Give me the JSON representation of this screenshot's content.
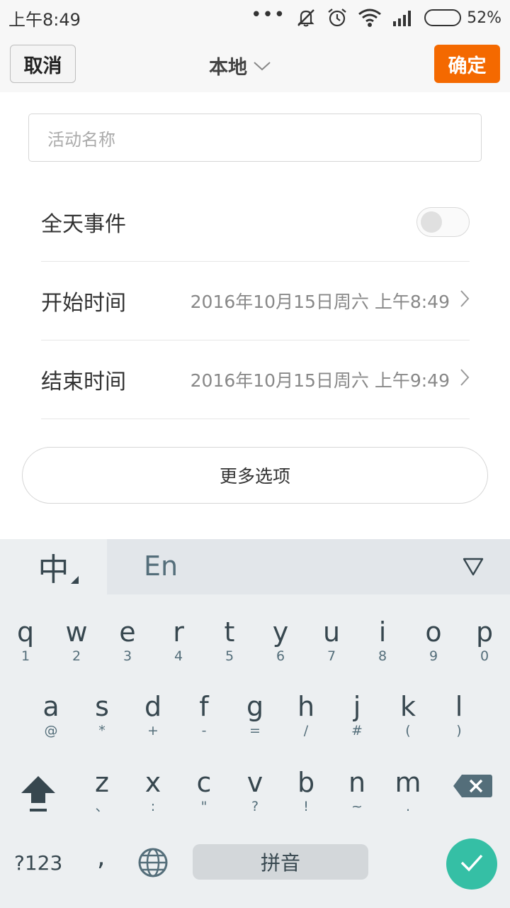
{
  "status_bar": {
    "time": "上午8:49",
    "battery_level": 52,
    "battery_text": "52%",
    "icons": [
      "more-dots-icon",
      "mute-icon",
      "alarm-icon",
      "wifi-icon",
      "signal-icon",
      "battery-icon"
    ]
  },
  "top_bar": {
    "cancel_label": "取消",
    "calendar_label": "本地",
    "confirm_label": "确定",
    "confirm_color": "#f46900"
  },
  "form": {
    "event_name_placeholder": "活动名称",
    "all_day_label": "全天事件",
    "all_day_on": false,
    "start_label": "开始时间",
    "start_value": "2016年10月15日周六 上午8:49",
    "end_label": "结束时间",
    "end_value": "2016年10月15日周六 上午9:49",
    "more_options_label": "更多选项"
  },
  "keyboard": {
    "lang_zh": "中",
    "lang_en": "En",
    "row1": [
      {
        "key": "q",
        "sub": "1"
      },
      {
        "key": "w",
        "sub": "2"
      },
      {
        "key": "e",
        "sub": "3"
      },
      {
        "key": "r",
        "sub": "4"
      },
      {
        "key": "t",
        "sub": "5"
      },
      {
        "key": "y",
        "sub": "6"
      },
      {
        "key": "u",
        "sub": "7"
      },
      {
        "key": "i",
        "sub": "8"
      },
      {
        "key": "o",
        "sub": "9"
      },
      {
        "key": "p",
        "sub": "0"
      }
    ],
    "row2": [
      {
        "key": "a",
        "sub": "@"
      },
      {
        "key": "s",
        "sub": "*"
      },
      {
        "key": "d",
        "sub": "+"
      },
      {
        "key": "f",
        "sub": "-"
      },
      {
        "key": "g",
        "sub": "="
      },
      {
        "key": "h",
        "sub": "/"
      },
      {
        "key": "j",
        "sub": "#"
      },
      {
        "key": "k",
        "sub": "("
      },
      {
        "key": "l",
        "sub": ")"
      }
    ],
    "row3": [
      {
        "key": "z",
        "sub": "、"
      },
      {
        "key": "x",
        "sub": ":"
      },
      {
        "key": "c",
        "sub": "\""
      },
      {
        "key": "v",
        "sub": "?"
      },
      {
        "key": "b",
        "sub": "!"
      },
      {
        "key": "n",
        "sub": "~"
      },
      {
        "key": "m",
        "sub": "."
      }
    ],
    "symbols_label": "?123",
    "comma_label": ",",
    "space_label": "拼音",
    "enter_color": "#35bfa5"
  }
}
